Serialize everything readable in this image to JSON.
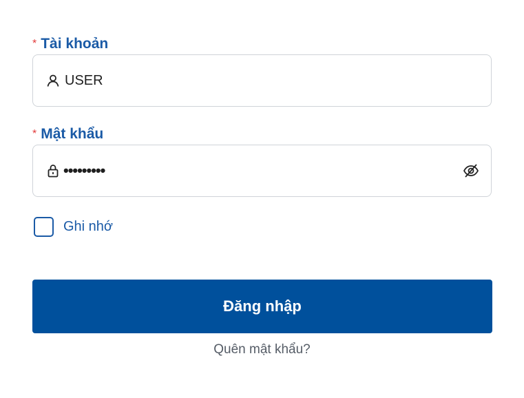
{
  "form": {
    "account": {
      "required_mark": "*",
      "label": "Tài khoản",
      "value": "USER",
      "icon": "user-icon"
    },
    "password": {
      "required_mark": "*",
      "label": "Mật khẩu",
      "value": "•••••••••",
      "icon": "lock-icon",
      "toggle_icon": "eye-off-icon"
    },
    "remember": {
      "label": "Ghi nhớ",
      "checked": false
    },
    "submit_label": "Đăng nhập",
    "forgot_label": "Quên mật khẩu?"
  },
  "colors": {
    "label": "#1a5aa6",
    "required": "#e23b3b",
    "button": "#00509c",
    "link": "#555c66"
  }
}
